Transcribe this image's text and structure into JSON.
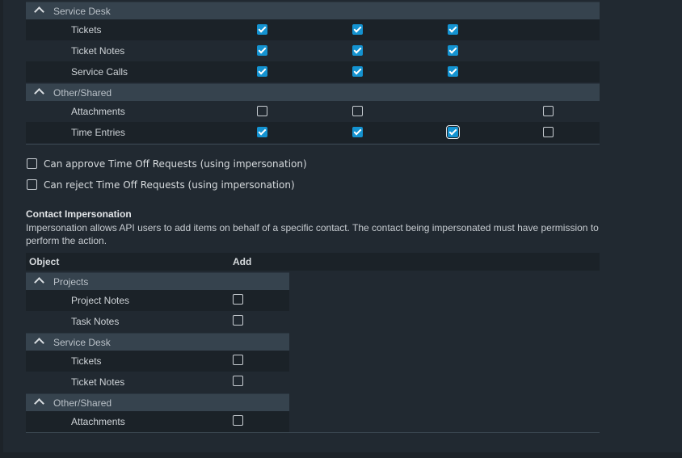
{
  "access_table": {
    "groups": [
      {
        "label": "Service Desk",
        "items": [
          {
            "label": "Tickets",
            "checks": [
              true,
              true,
              true,
              null
            ]
          },
          {
            "label": "Ticket Notes",
            "checks": [
              true,
              true,
              true,
              null
            ]
          },
          {
            "label": "Service Calls",
            "checks": [
              true,
              true,
              true,
              null
            ]
          }
        ]
      },
      {
        "label": "Other/Shared",
        "items": [
          {
            "label": "Attachments",
            "checks": [
              false,
              false,
              null,
              false
            ]
          },
          {
            "label": "Time Entries",
            "checks": [
              true,
              true,
              true,
              false
            ]
          }
        ]
      }
    ]
  },
  "options": {
    "approve_label": "Can approve Time Off Requests (using impersonation)",
    "approve_checked": false,
    "reject_label": "Can reject Time Off Requests (using impersonation)",
    "reject_checked": false
  },
  "contact_impersonation": {
    "title": "Contact Impersonation",
    "description": "Impersonation allows API users to add items on behalf of a specific contact. The contact being impersonated must have permission to perform the action.",
    "header_object": "Object",
    "header_add": "Add",
    "groups": [
      {
        "label": "Projects",
        "items": [
          {
            "label": "Project Notes",
            "add": false
          },
          {
            "label": "Task Notes",
            "add": false
          }
        ]
      },
      {
        "label": "Service Desk",
        "items": [
          {
            "label": "Tickets",
            "add": false
          },
          {
            "label": "Ticket Notes",
            "add": false
          }
        ]
      },
      {
        "label": "Other/Shared",
        "items": [
          {
            "label": "Attachments",
            "add": false
          }
        ]
      }
    ]
  },
  "colors": {
    "accent": "#1493d1",
    "background": "#212931",
    "group_header": "#36434e"
  }
}
